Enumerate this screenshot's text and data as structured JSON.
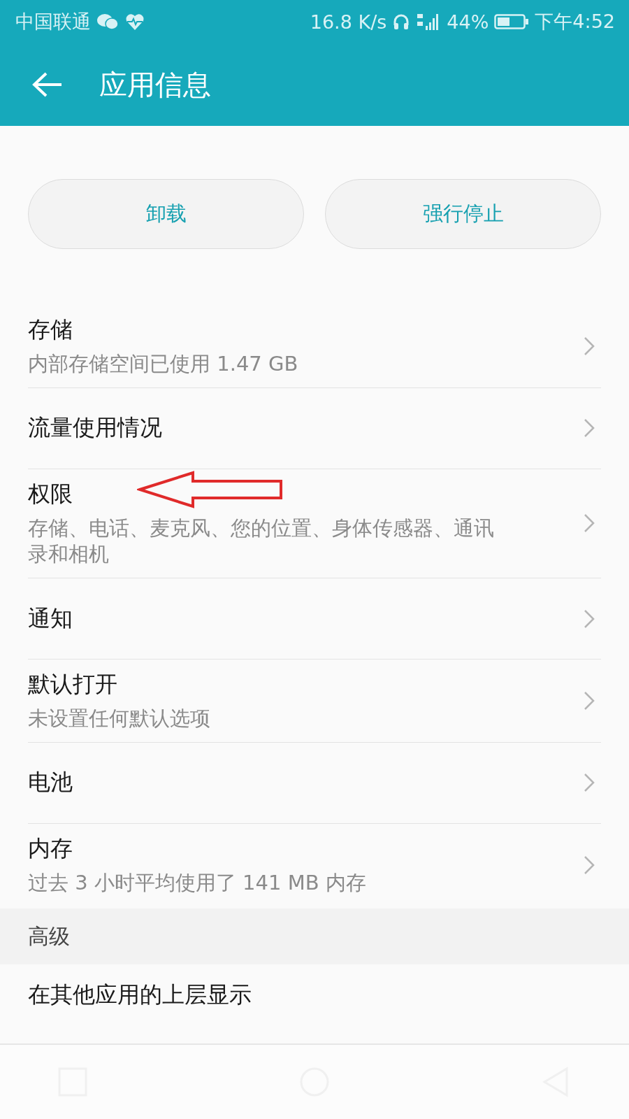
{
  "status_bar": {
    "carrier": "中国联通",
    "speed": "16.8 K/s",
    "battery": "44%",
    "time": "下午4:52"
  },
  "header": {
    "title": "应用信息"
  },
  "buttons": [
    "卸载",
    "强行停止"
  ],
  "rows": [
    {
      "title": "存储",
      "subtitle": "内部存储空间已使用 1.47 GB"
    },
    {
      "title": "流量使用情况"
    },
    {
      "title": "权限",
      "subtitle": "存储、电话、麦克风、您的位置、身体传感器、通讯录和相机"
    },
    {
      "title": "通知"
    },
    {
      "title": "默认打开",
      "subtitle": "未设置任何默认选项"
    },
    {
      "title": "电池"
    },
    {
      "title": "内存",
      "subtitle": "过去 3 小时平均使用了 141 MB 内存"
    }
  ],
  "section": {
    "title": "高级",
    "rows": [
      {
        "title": "在其他应用的上层显示"
      }
    ]
  }
}
